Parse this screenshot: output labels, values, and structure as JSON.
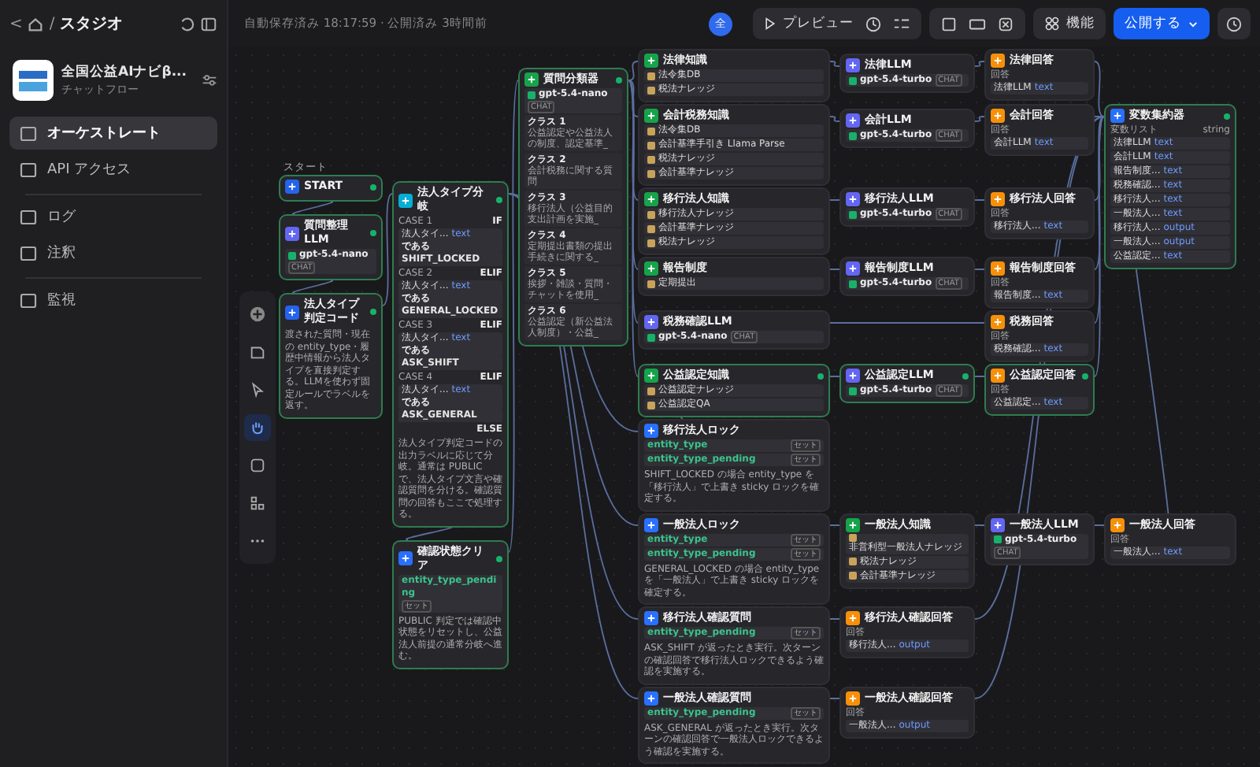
{
  "breadcrumb": {
    "back": "<",
    "separator": "/",
    "label": "スタジオ"
  },
  "app": {
    "name": "全国公益AIナビβ...",
    "type": "チャットフロー"
  },
  "nav": [
    {
      "label": "オーケストレート",
      "selected": true
    },
    {
      "label": "API アクセス",
      "selected": false
    },
    {
      "label": "ログ",
      "selected": false
    },
    {
      "label": "注釈",
      "selected": false
    },
    {
      "label": "監視",
      "selected": false
    }
  ],
  "status": "自動保存済み 18:17:59 · 公開済み 3時間前",
  "toolbar": {
    "avatar": "全",
    "preview": "プレビュー",
    "features": "機能",
    "publish": "公開する"
  },
  "canvas_tools": [
    {
      "kind": "add",
      "selected": false
    },
    {
      "kind": "note",
      "selected": false
    },
    {
      "kind": "pointer",
      "selected": false
    },
    {
      "kind": "hand",
      "selected": true
    },
    {
      "kind": "comment",
      "selected": false
    },
    {
      "kind": "layout",
      "selected": false
    },
    {
      "kind": "more",
      "selected": false
    }
  ],
  "nodes": [
    {
      "kind": "start",
      "title": "START",
      "caption": "スタート",
      "selected": true
    },
    {
      "kind": "llm",
      "title": "質問整理LLM",
      "selected": true,
      "model": {
        "name": "gpt-5.4-nano",
        "mode": "CHAT"
      }
    },
    {
      "kind": "code",
      "title": "法人タイプ判定コード",
      "selected": true,
      "description": "渡された質問・現在の entity_type・履歴中情報から法人タイプを直接判定する。LLMを使わず固定ルールでラベルを返す。"
    },
    {
      "kind": "if",
      "title": "法人タイプ分岐",
      "selected": true,
      "cases": [
        {
          "case": "CASE 1",
          "op": "IF",
          "lhs": "法人タイ...",
          "type": "text",
          "cmp": "である",
          "value": "SHIFT_LOCKED"
        },
        {
          "case": "CASE 2",
          "op": "ELIF",
          "lhs": "法人タイ...",
          "type": "text",
          "cmp": "である",
          "value": "GENERAL_LOCKED"
        },
        {
          "case": "CASE 3",
          "op": "ELIF",
          "lhs": "法人タイ...",
          "type": "text",
          "cmp": "である",
          "value": "ASK_SHIFT"
        },
        {
          "case": "CASE 4",
          "op": "ELIF",
          "lhs": "法人タイ...",
          "type": "text",
          "cmp": "である",
          "value": "ASK_GENERAL"
        }
      ],
      "else": "ELSE",
      "description": "法人タイプ判定コードの出力ラベルに応じて分岐。通常は PUBLIC で、法人タイプ文言や確認質問を分ける。確認質問の回答もここで処理する。"
    },
    {
      "kind": "assigner",
      "title": "確認状態クリア",
      "selected": true,
      "variables": [
        {
          "name": "entity_type_pending",
          "op": "セット"
        }
      ],
      "description": "PUBLIC 判定では確認中状態をリセットし、公益法人前提の通常分岐へ進む。"
    },
    {
      "kind": "classifier",
      "title": "質問分類器",
      "selected": true,
      "model": {
        "name": "gpt-5.4-nano",
        "mode": "CHAT"
      },
      "classes": [
        {
          "name": "クラス 1",
          "text": "公益認定や公益法人の制度、認定基準_"
        },
        {
          "name": "クラス 2",
          "text": "会計税務に関する質問"
        },
        {
          "name": "クラス 3",
          "text": "移行法人（公益目的支出計画を実施_"
        },
        {
          "name": "クラス 4",
          "text": "定期提出書類の提出手続きに関する_"
        },
        {
          "name": "クラス 5",
          "text": "挨拶・雑談・質問・チャットを使用_"
        },
        {
          "name": "クラス 6",
          "text": "公益認定（新公益法人制度）・公益_"
        }
      ]
    },
    {
      "kind": "knowledge",
      "title": "法律知識",
      "selected": false,
      "items": [
        "法令集DB",
        "税法ナレッジ"
      ]
    },
    {
      "kind": "knowledge",
      "title": "会計税務知識",
      "selected": false,
      "items": [
        "法令集DB",
        "会計基準手引き Llama Parse",
        "税法ナレッジ",
        "会計基準ナレッジ"
      ]
    },
    {
      "kind": "knowledge",
      "title": "移行法人知識",
      "selected": false,
      "items": [
        "移行法人ナレッジ",
        "会計基準ナレッジ",
        "税法ナレッジ"
      ]
    },
    {
      "kind": "knowledge",
      "title": "報告制度",
      "selected": false,
      "items": [
        "定期提出"
      ]
    },
    {
      "kind": "llm",
      "title": "税務確認LLM",
      "selected": false,
      "model": {
        "name": "gpt-5.4-nano",
        "mode": "CHAT"
      }
    },
    {
      "kind": "knowledge",
      "title": "公益認定知識",
      "selected": true,
      "items": [
        "公益認定ナレッジ",
        "公益認定QA"
      ]
    },
    {
      "kind": "assigner",
      "title": "移行法人ロック",
      "selected": false,
      "variables": [
        {
          "name": "entity_type",
          "op": "セット"
        },
        {
          "name": "entity_type_pending",
          "op": "セット"
        }
      ],
      "description": "SHIFT_LOCKED の場合 entity_type を「移行法人」で上書き sticky ロックを確定する。"
    },
    {
      "kind": "assigner",
      "title": "一般法人ロック",
      "selected": false,
      "variables": [
        {
          "name": "entity_type",
          "op": "セット"
        },
        {
          "name": "entity_type_pending",
          "op": "セット"
        }
      ],
      "description": "GENERAL_LOCKED の場合 entity_type を「一般法人」で上書き sticky ロックを確定する。"
    },
    {
      "kind": "assigner",
      "title": "移行法人確認質問",
      "selected": false,
      "variables": [
        {
          "name": "entity_type_pending",
          "op": "セット"
        }
      ],
      "description": "ASK_SHIFT が返ったとき実行。次ターンの確認回答で移行法人ロックできるよう確認を実施する。"
    },
    {
      "kind": "assigner",
      "title": "一般法人確認質問",
      "selected": false,
      "variables": [
        {
          "name": "entity_type_pending",
          "op": "セット"
        }
      ],
      "description": "ASK_GENERAL が返ったとき実行。次ターンの確認回答で一般法人ロックできるよう確認を実施する。"
    },
    {
      "kind": "llm",
      "title": "法律LLM",
      "selected": false,
      "model": {
        "name": "gpt-5.4-turbo",
        "mode": "CHAT"
      }
    },
    {
      "kind": "llm",
      "title": "会計LLM",
      "selected": false,
      "model": {
        "name": "gpt-5.4-turbo",
        "mode": "CHAT"
      }
    },
    {
      "kind": "llm",
      "title": "移行法人LLM",
      "selected": false,
      "model": {
        "name": "gpt-5.4-turbo",
        "mode": "CHAT"
      }
    },
    {
      "kind": "llm",
      "title": "報告制度LLM",
      "selected": false,
      "model": {
        "name": "gpt-5.4-turbo",
        "mode": "CHAT"
      }
    },
    {
      "kind": "llm",
      "title": "公益認定LLM",
      "selected": true,
      "model": {
        "name": "gpt-5.4-turbo",
        "mode": "CHAT"
      }
    },
    {
      "kind": "knowledge",
      "title": "一般法人知識",
      "selected": false,
      "items": [
        "非営利型一般法人ナレッジ",
        "税法ナレッジ",
        "会計基準ナレッジ"
      ]
    },
    {
      "kind": "answer",
      "title": "移行法人確認回答",
      "selected": false,
      "label": "回答",
      "ref": "移行法人...",
      "type": "output"
    },
    {
      "kind": "answer",
      "title": "一般法人確認回答",
      "selected": false,
      "label": "回答",
      "ref": "一般法人...",
      "type": "output"
    },
    {
      "kind": "answer",
      "title": "法律回答",
      "selected": false,
      "label": "回答",
      "ref": "法律LLM",
      "type": "text"
    },
    {
      "kind": "answer",
      "title": "会計回答",
      "selected": false,
      "label": "回答",
      "ref": "会計LLM",
      "type": "text"
    },
    {
      "kind": "answer",
      "title": "移行法人回答",
      "selected": false,
      "label": "回答",
      "ref": "移行法人...",
      "type": "text"
    },
    {
      "kind": "answer",
      "title": "報告制度回答",
      "selected": false,
      "label": "回答",
      "ref": "報告制度...",
      "type": "text"
    },
    {
      "kind": "answer",
      "title": "税務回答",
      "selected": false,
      "label": "回答",
      "ref": "税務確認...",
      "type": "text"
    },
    {
      "kind": "answer",
      "title": "公益認定回答",
      "selected": true,
      "label": "回答",
      "ref": "公益認定...",
      "type": "text"
    },
    {
      "kind": "llm",
      "title": "一般法人LLM",
      "selected": false,
      "model": {
        "name": "gpt-5.4-turbo",
        "mode": "CHAT"
      }
    },
    {
      "kind": "aggregator",
      "title": "変数集約器",
      "selected": true,
      "label": "変数リスト",
      "vartype": "string",
      "refs": [
        {
          "ref": "法律LLM",
          "type": "text"
        },
        {
          "ref": "会計LLM",
          "type": "text"
        },
        {
          "ref": "報告制度...",
          "type": "text"
        },
        {
          "ref": "税務確認...",
          "type": "text"
        },
        {
          "ref": "移行法人...",
          "type": "text"
        },
        {
          "ref": "一般法人...",
          "type": "text"
        },
        {
          "ref": "移行法人...",
          "type": "output"
        },
        {
          "ref": "一般法人...",
          "type": "output"
        },
        {
          "ref": "公益認定...",
          "type": "text"
        }
      ]
    },
    {
      "kind": "answer",
      "title": "一般法人回答",
      "selected": false,
      "label": "回答",
      "ref": "一般法人...",
      "type": "text"
    }
  ]
}
